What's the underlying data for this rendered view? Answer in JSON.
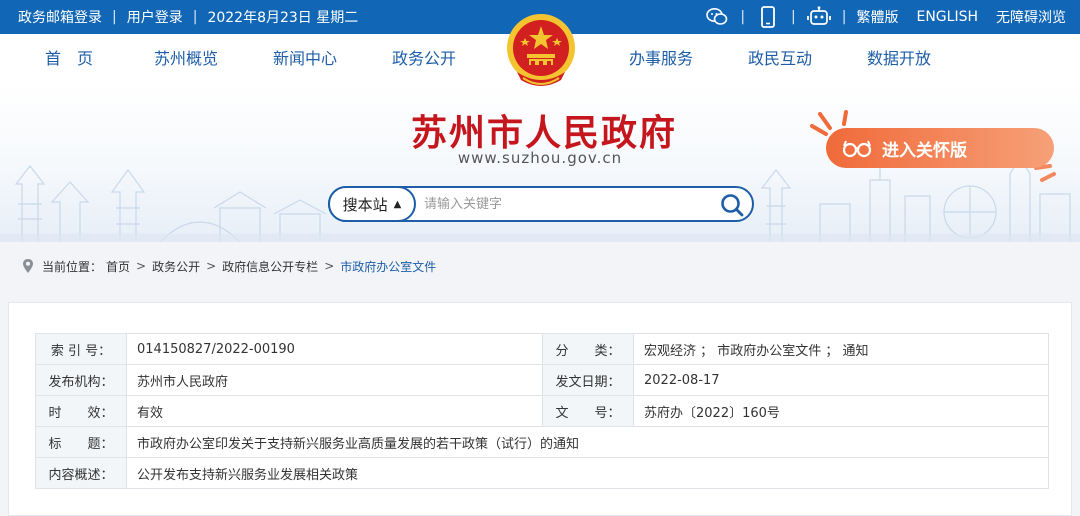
{
  "topbar": {
    "mail_login": "政务邮箱登录",
    "user_login": "用户登录",
    "date": "2022年8月23日 星期二",
    "traditional": "繁體版",
    "english": "ENGLISH",
    "accessible": "无障碍浏览"
  },
  "nav": {
    "items": [
      "首　页",
      "苏州概览",
      "新闻中心",
      "政务公开",
      "办事服务",
      "政民互动",
      "数据开放"
    ]
  },
  "banner": {
    "site_title": "苏州市人民政府",
    "site_url": "www.suzhou.gov.cn",
    "care_label": "进入关怀版"
  },
  "search": {
    "scope": "搜本站",
    "placeholder": "请输入关键字"
  },
  "breadcrumb": {
    "prefix": "当前位置：",
    "items": [
      "首页",
      "政务公开",
      "政府信息公开专栏",
      "市政府办公室文件"
    ]
  },
  "meta": {
    "index_label": "索 引 号：",
    "index_value": "014150827/2022-00190",
    "category_label": "分　　类：",
    "category_value": "宏观经济 ； 市政府办公室文件 ； 通知",
    "publisher_label": "发布机构：",
    "publisher_value": "苏州市人民政府",
    "date_label": "发文日期：",
    "date_value": "2022-08-17",
    "validity_label": "时　　效：",
    "validity_value": "有效",
    "docno_label": "文　　号：",
    "docno_value": "苏府办〔2022〕160号",
    "title_label": "标　　题：",
    "title_value": "市政府办公室印发关于支持新兴服务业高质量发展的若干政策（试行）的通知",
    "summary_label": "内容概述：",
    "summary_value": "公开发布支持新兴服务业发展相关政策"
  },
  "colors": {
    "topbar": "#1167b6",
    "nav_text": "#1e5ea8",
    "title_red": "#c4161c",
    "care_orange": "#f06a3a"
  },
  "icons": [
    "wechat-icon",
    "mobile-icon",
    "robot-icon",
    "search-icon",
    "location-icon",
    "glasses-icon",
    "national-emblem"
  ]
}
